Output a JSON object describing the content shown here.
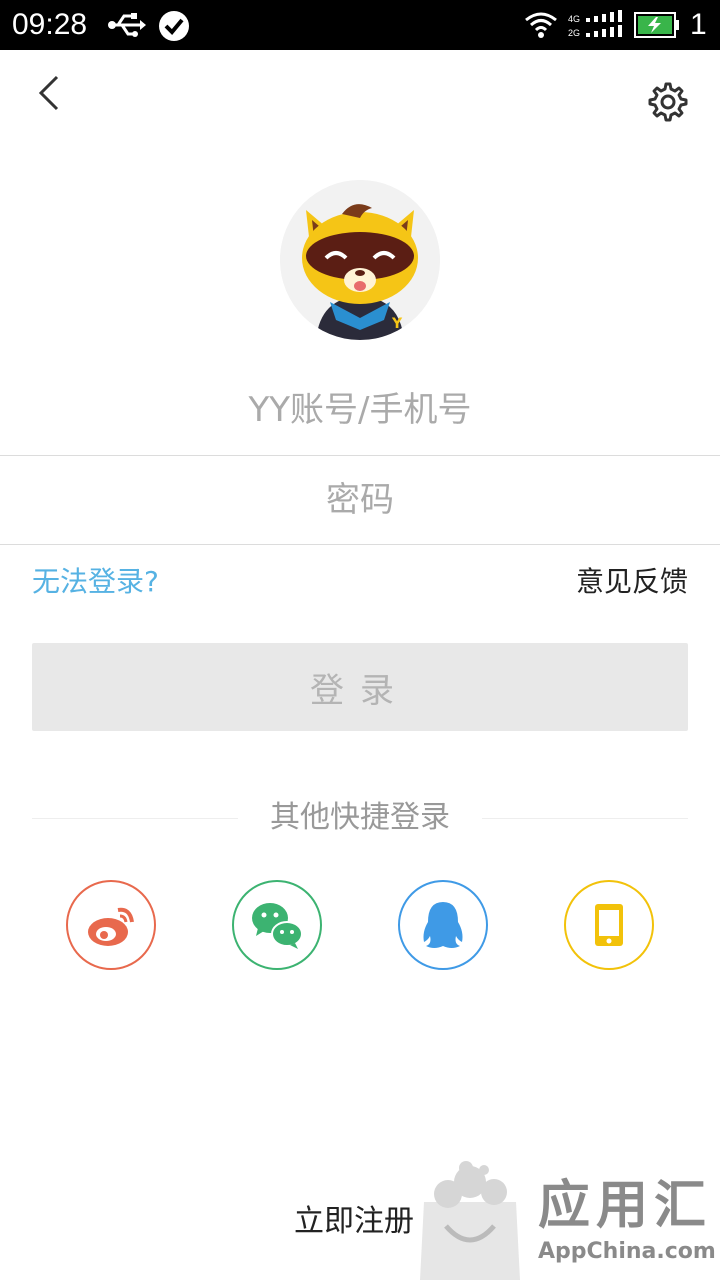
{
  "status_bar": {
    "time": "09:28",
    "battery_level": "1",
    "network_4g": "4G",
    "network_2g": "2G",
    "icons": [
      "usb-icon",
      "check-circle-icon",
      "wifi-icon",
      "signal-icon",
      "battery-charging-icon"
    ]
  },
  "header": {
    "back_icon": "chevron-left-icon",
    "settings_icon": "gear-icon"
  },
  "avatar": {
    "icon": "yy-mascot-raccoon"
  },
  "form": {
    "account_placeholder": "YY账号/手机号",
    "password_placeholder": "密码",
    "cant_login_label": "无法登录?",
    "feedback_label": "意见反馈",
    "login_label": "登录"
  },
  "quick_login": {
    "title": "其他快捷登录",
    "providers": [
      {
        "name": "weibo",
        "icon": "weibo-icon",
        "color": "#e8694d"
      },
      {
        "name": "wechat",
        "icon": "wechat-icon",
        "color": "#3cb371"
      },
      {
        "name": "qq",
        "icon": "qq-penguin-icon",
        "color": "#3f9ae6"
      },
      {
        "name": "phone",
        "icon": "phone-icon",
        "color": "#f2c20a"
      }
    ]
  },
  "footer": {
    "register_label": "立即注册"
  },
  "watermark": {
    "title": "应用汇",
    "subtitle": "AppChina.com"
  },
  "colors": {
    "link_blue": "#56b2e3",
    "login_disabled_bg": "#e8e8e8",
    "login_disabled_text": "#b4b4b4"
  }
}
